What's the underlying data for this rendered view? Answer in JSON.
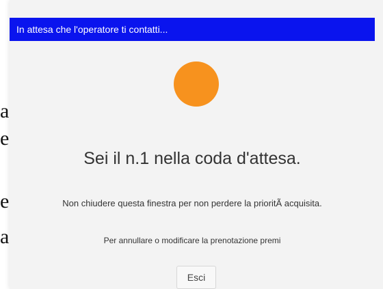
{
  "background": {
    "fragments": [
      "a",
      "e",
      "e",
      "a"
    ]
  },
  "dialog": {
    "title": "In attesa che l'operatore ti contatti...",
    "status_indicator_color": "#f7921e",
    "queue_message": "Sei il n.1 nella coda d'attesa.",
    "notice": "Non chiudere questa finestra per non perdere la prioritÃ  acquisita.",
    "cancel_hint": "Per annullare o modificare la prenotazione premi",
    "exit_label": "Esci"
  },
  "colors": {
    "titlebar": "#0a14ee",
    "dialog_bg": "#f3f3f3"
  }
}
